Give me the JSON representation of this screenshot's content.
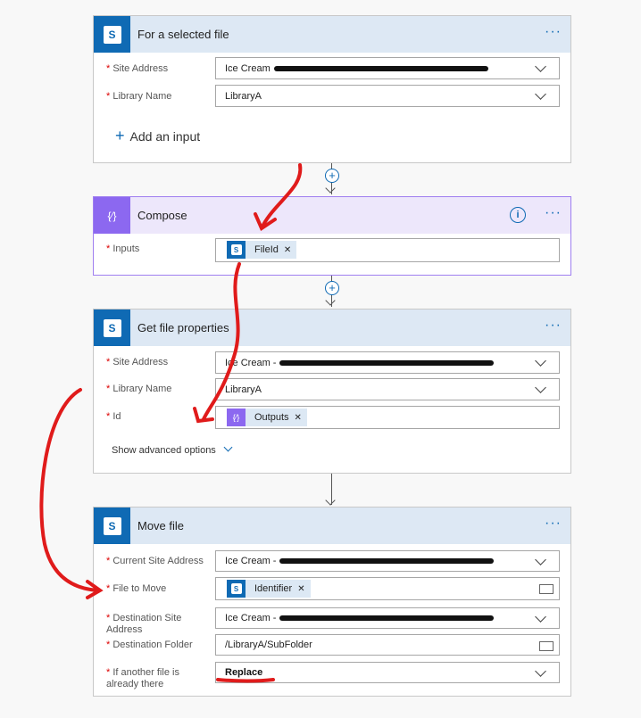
{
  "trigger": {
    "title": "For a selected file",
    "site_label": "Site Address",
    "site_value": "Ice Cream",
    "library_label": "Library Name",
    "library_value": "LibraryA",
    "add_input": "Add an input"
  },
  "compose": {
    "title": "Compose",
    "inputs_label": "Inputs",
    "token": "FileId"
  },
  "get_props": {
    "title": "Get file properties",
    "site_label": "Site Address",
    "site_value": "Ice Cream -",
    "library_label": "Library Name",
    "library_value": "LibraryA",
    "id_label": "Id",
    "token": "Outputs",
    "advanced": "Show advanced options"
  },
  "move": {
    "title": "Move file",
    "current_site_label": "Current Site Address",
    "current_site_value": "Ice Cream -",
    "file_label": "File to Move",
    "file_token": "Identifier",
    "dest_site_label": "Destination Site Address",
    "dest_site_value": "Ice Cream -",
    "dest_folder_label": "Destination Folder",
    "dest_folder_value": "/LibraryA/SubFolder",
    "conflict_label": "If another file is already there",
    "conflict_value": "Replace"
  },
  "icons": {
    "sharepoint": "sharepoint-icon",
    "compose": "compose-icon",
    "menu": "more-dots-icon",
    "info": "info-icon",
    "chevron": "chevron-down-icon",
    "folder": "folder-icon"
  },
  "colors": {
    "sharepoint": "#0f6ab4",
    "compose": "#8c68f0",
    "annotation": "#e01b1b"
  }
}
